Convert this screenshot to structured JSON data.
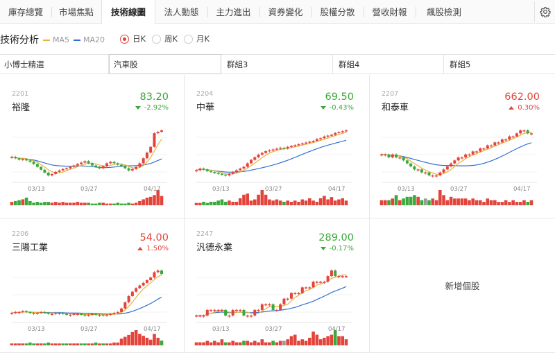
{
  "tabs": [
    {
      "label": "庫存總覽",
      "active": false
    },
    {
      "label": "市場焦點",
      "active": false
    },
    {
      "label": "技術線圖",
      "active": true
    },
    {
      "label": "法人動態",
      "active": false
    },
    {
      "label": "主力進出",
      "active": false
    },
    {
      "label": "資券變化",
      "active": false
    },
    {
      "label": "股權分散",
      "active": false
    },
    {
      "label": "營收財報",
      "active": false
    },
    {
      "label": "飆股檢測",
      "active": false
    }
  ],
  "toolbar": {
    "title": "技術分析",
    "ma5_label": "MA5",
    "ma20_label": "MA20",
    "periods": [
      {
        "label": "日K",
        "selected": true
      },
      {
        "label": "周K",
        "selected": false
      },
      {
        "label": "月K",
        "selected": false
      }
    ]
  },
  "groups": [
    {
      "label": "小博士精選",
      "active": false
    },
    {
      "label": "汽車股",
      "active": true
    },
    {
      "label": "群組3",
      "active": false
    },
    {
      "label": "群組4",
      "active": false
    },
    {
      "label": "群組5",
      "active": false
    }
  ],
  "add_stock_label": "新增個股",
  "colors": {
    "up": "#e2443b",
    "down": "#3aa83a",
    "ma5": "#e8b43a",
    "ma20": "#2f6fd1",
    "neutral_volume": "#999999"
  },
  "date_labels": [
    "03/13",
    "03/27",
    "04/17"
  ],
  "stocks": [
    {
      "code": "2201",
      "name": "裕隆",
      "price": "83.20",
      "change": "-2.92%",
      "direction": "down",
      "closes": [
        82.2,
        82.0,
        81.8,
        81.9,
        81.7,
        81.5,
        81.2,
        80.8,
        80.4,
        80.0,
        79.6,
        79.8,
        80.1,
        80.3,
        80.5,
        80.6,
        80.8,
        81.0,
        81.2,
        81.4,
        81.6,
        81.3,
        81.0,
        80.8,
        80.6,
        80.9,
        81.3,
        81.5,
        81.3,
        81.1,
        80.9,
        80.6,
        80.3,
        80.5,
        80.8,
        81.3,
        82.0,
        82.8,
        83.6,
        85.5,
        85.7,
        85.9
      ],
      "volumes": [
        4,
        5,
        6,
        7,
        9,
        5,
        3,
        4,
        3,
        4,
        4,
        3,
        4,
        3,
        4,
        3,
        3,
        3,
        4,
        3,
        3,
        3,
        2,
        2,
        3,
        3,
        2,
        2,
        2,
        3,
        2,
        2,
        3,
        2,
        3,
        5,
        7,
        9,
        10,
        12,
        18,
        11
      ]
    },
    {
      "code": "2204",
      "name": "中華",
      "price": "69.50",
      "change": "-0.43%",
      "direction": "down",
      "closes": [
        65.0,
        65.2,
        65.1,
        64.9,
        64.8,
        64.7,
        64.6,
        64.5,
        64.4,
        64.6,
        64.8,
        65.0,
        65.2,
        65.4,
        65.8,
        66.2,
        66.5,
        66.8,
        67.0,
        67.2,
        67.3,
        67.4,
        67.5,
        67.6,
        67.5,
        67.7,
        67.8,
        67.9,
        68.0,
        68.1,
        68.2,
        68.3,
        68.4,
        68.6,
        68.7,
        68.9,
        69.0,
        69.1,
        69.3,
        69.4,
        69.5,
        69.6
      ],
      "volumes": [
        2,
        2,
        3,
        2,
        3,
        3,
        4,
        5,
        3,
        4,
        3,
        3,
        6,
        9,
        10,
        4,
        5,
        9,
        13,
        9,
        5,
        4,
        5,
        4,
        3,
        4,
        3,
        4,
        3,
        5,
        4,
        6,
        4,
        3,
        6,
        8,
        5,
        7,
        4,
        5,
        6,
        4
      ],
      "neutral": []
    },
    {
      "code": "2207",
      "name": "和泰車",
      "price": "662.00",
      "change": "0.30%",
      "direction": "up",
      "closes": [
        655,
        655,
        654,
        655,
        654,
        654,
        653,
        652,
        651,
        650,
        650,
        649,
        649,
        648,
        648,
        648,
        649,
        650,
        651,
        652,
        653,
        654,
        654,
        655,
        655,
        656,
        656,
        657,
        657,
        658,
        658,
        659,
        659,
        660,
        660,
        661,
        661,
        662,
        663,
        663,
        662,
        662
      ],
      "volumes": [
        3,
        3,
        3,
        4,
        6,
        3,
        4,
        5,
        5,
        6,
        5,
        3,
        4,
        3,
        4,
        3,
        9,
        6,
        3,
        5,
        4,
        4,
        4,
        4,
        3,
        4,
        3,
        3,
        2,
        4,
        3,
        3,
        2,
        2,
        3,
        2,
        3,
        2,
        2,
        3,
        2,
        3
      ],
      "neutral": [
        12
      ]
    },
    {
      "code": "2206",
      "name": "三陽工業",
      "price": "54.00",
      "change": "1.50%",
      "direction": "up",
      "closes": [
        49.6,
        49.7,
        49.7,
        49.8,
        49.7,
        49.6,
        49.5,
        49.6,
        49.7,
        49.6,
        49.5,
        49.5,
        49.6,
        49.6,
        49.5,
        49.4,
        49.4,
        49.5,
        49.5,
        49.4,
        49.3,
        49.4,
        49.5,
        49.4,
        49.4,
        49.3,
        49.4,
        49.5,
        49.6,
        49.7,
        50.1,
        50.8,
        51.5,
        52.0,
        52.4,
        52.7,
        53.0,
        53.3,
        53.6,
        54.2,
        54.4,
        54.0
      ],
      "volumes": [
        2,
        2,
        2,
        2,
        2,
        3,
        2,
        2,
        2,
        2,
        3,
        2,
        2,
        2,
        2,
        2,
        2,
        2,
        2,
        2,
        2,
        2,
        2,
        3,
        2,
        2,
        2,
        2,
        3,
        3,
        7,
        9,
        11,
        14,
        16,
        12,
        10,
        8,
        6,
        12,
        8,
        5
      ],
      "neutral": []
    },
    {
      "code": "2247",
      "name": "汎德永業",
      "price": "289.00",
      "change": "-0.17%",
      "direction": "down",
      "closes": [
        282,
        282,
        282,
        283,
        283,
        283,
        283,
        283,
        282,
        282,
        283,
        283,
        283,
        282,
        282,
        282,
        283,
        283,
        284,
        284,
        284,
        283,
        283,
        284,
        285,
        285,
        286,
        286,
        286,
        287,
        287,
        287,
        288,
        288,
        288,
        288,
        289,
        290,
        289,
        289,
        289,
        289
      ],
      "volumes": [
        2,
        2,
        2,
        3,
        2,
        3,
        2,
        4,
        2,
        2,
        3,
        2,
        2,
        3,
        3,
        2,
        3,
        2,
        4,
        2,
        2,
        3,
        2,
        3,
        3,
        4,
        6,
        7,
        3,
        4,
        3,
        5,
        9,
        7,
        4,
        5,
        6,
        7,
        10,
        6,
        6,
        4
      ],
      "neutral": [
        24
      ]
    }
  ]
}
